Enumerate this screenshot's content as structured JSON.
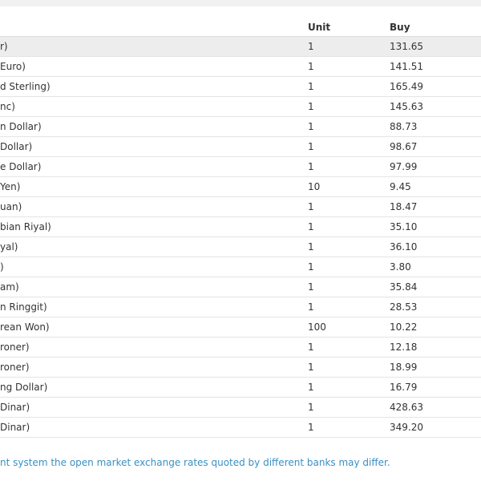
{
  "table": {
    "headers": {
      "currency": "",
      "unit": "Unit",
      "buy": "Buy"
    },
    "rows": [
      {
        "currency": "r)",
        "unit": "1",
        "buy": "131.65"
      },
      {
        "currency": " Euro)",
        "unit": "1",
        "buy": "141.51"
      },
      {
        "currency": "d Sterling)",
        "unit": "1",
        "buy": "165.49"
      },
      {
        "currency": "nc)",
        "unit": "1",
        "buy": "145.63"
      },
      {
        "currency": "n Dollar)",
        "unit": "1",
        "buy": "88.73"
      },
      {
        "currency": " Dollar)",
        "unit": "1",
        "buy": "98.67"
      },
      {
        "currency": "e Dollar)",
        "unit": "1",
        "buy": "97.99"
      },
      {
        "currency": "Yen)",
        "unit": "10",
        "buy": "9.45"
      },
      {
        "currency": "uan)",
        "unit": "1",
        "buy": "18.47"
      },
      {
        "currency": "bian Riyal)",
        "unit": "1",
        "buy": "35.10"
      },
      {
        "currency": "yal)",
        "unit": "1",
        "buy": "36.10"
      },
      {
        "currency": ")",
        "unit": "1",
        "buy": "3.80"
      },
      {
        "currency": "am)",
        "unit": "1",
        "buy": "35.84"
      },
      {
        "currency": "n Ringgit)",
        "unit": "1",
        "buy": "28.53"
      },
      {
        "currency": "rean Won)",
        "unit": "100",
        "buy": "10.22"
      },
      {
        "currency": "roner)",
        "unit": "1",
        "buy": "12.18"
      },
      {
        "currency": "roner)",
        "unit": "1",
        "buy": "18.99"
      },
      {
        "currency": "ng Dollar)",
        "unit": "1",
        "buy": "16.79"
      },
      {
        "currency": "Dinar)",
        "unit": "1",
        "buy": "428.63"
      },
      {
        "currency": "Dinar)",
        "unit": "1",
        "buy": "349.20"
      }
    ]
  },
  "footnote": "nt system the open market exchange rates quoted by different banks may differ.",
  "colors": {
    "highlight_row": "#ededed",
    "footnote_link": "#3a8fc4",
    "page_background": "#f1f1f1"
  }
}
